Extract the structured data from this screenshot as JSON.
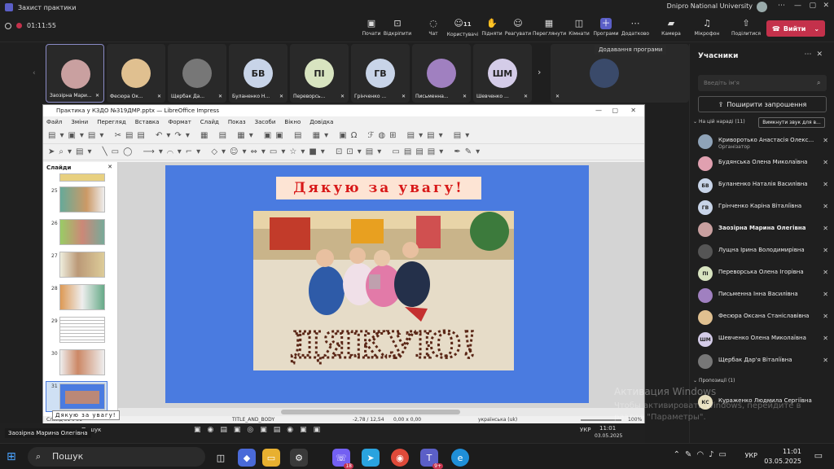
{
  "window": {
    "title": "Захист практики",
    "organization": "Dnipro National University"
  },
  "meeting": {
    "timer": "01:11:55",
    "leave_label": "Вийти"
  },
  "toolbar": {
    "items": [
      {
        "label": "Почати",
        "icon": "camera-icon"
      },
      {
        "label": "Відкріпити",
        "icon": "unpin-icon"
      },
      {
        "label": "Чат",
        "icon": "chat-icon"
      },
      {
        "label": "Користувачі",
        "icon": "people-icon",
        "count": "11"
      },
      {
        "label": "Підняти",
        "icon": "hand-icon"
      },
      {
        "label": "Реагувати",
        "icon": "smile-icon"
      },
      {
        "label": "Переглянути",
        "icon": "grid-icon"
      },
      {
        "label": "Кімнати",
        "icon": "rooms-icon"
      },
      {
        "label": "Програми",
        "icon": "apps-icon"
      },
      {
        "label": "Додатково",
        "icon": "more-icon"
      },
      {
        "label": "Камера",
        "icon": "video-icon"
      },
      {
        "label": "Мікрофон",
        "icon": "mic-icon"
      },
      {
        "label": "Поділитися",
        "icon": "share-icon"
      }
    ],
    "tooltip": "Додавання програми"
  },
  "tiles": [
    {
      "name": "Заозірна Мари...",
      "initials": "",
      "color": "#c9a0a0"
    },
    {
      "name": "Фесюра Ок...",
      "initials": "",
      "color": "#e0c090"
    },
    {
      "name": "Щербак Да...",
      "initials": "",
      "color": "#777777"
    },
    {
      "name": "Буланенко Н...",
      "initials": "БВ",
      "color": "#c8d4e8"
    },
    {
      "name": "Переворсь...",
      "initials": "ПІ",
      "color": "#d8e4c0"
    },
    {
      "name": "Грінченко ...",
      "initials": "ГВ",
      "color": "#c8d4e8"
    },
    {
      "name": "Письменна...",
      "initials": "",
      "color": "#a080c0"
    },
    {
      "name": "Шевченко ...",
      "initials": "ШМ",
      "color": "#d4cce8"
    },
    {
      "name": "",
      "initials": "",
      "color": "#3a4a6a"
    }
  ],
  "impress": {
    "title": "Практика у КЗДО №319ДМР.pptx — LibreOffice Impress",
    "menu": [
      "Файл",
      "Зміни",
      "Перегляд",
      "Вставка",
      "Формат",
      "Слайд",
      "Показ",
      "Засоби",
      "Вікно",
      "Довідка"
    ],
    "slides_header": "Слайди",
    "thumbnails": [
      "25",
      "26",
      "27",
      "28",
      "29",
      "30",
      "31"
    ],
    "slide_title": "Дякую за увагу!",
    "photo_word": "ДЯКУЮ!",
    "status": {
      "slide": "Слайд 31 з 31",
      "layout": "TITLE_AND_BODY",
      "position": "-2,78 / 12,54",
      "size": "0,00 x 0,00",
      "language": "українська (uk)",
      "zoom": "100%"
    },
    "slide_tooltip": "Дякую за увагу!"
  },
  "panel": {
    "title": "Учасники",
    "search_placeholder": "Введіть ім'я",
    "invite_label": "Поширити запрошення",
    "section_label": "На цій нараді (11)",
    "mute_label": "Вимкнути звук для в...",
    "people": [
      {
        "name": "Криворотько Анастасія Олекс...",
        "role": "Організатор",
        "initials": "",
        "color": "#8fa3b8"
      },
      {
        "name": "Будянська Олена Миколаївна",
        "role": "",
        "initials": "",
        "color": "#e0a0b0"
      },
      {
        "name": "Буланенко Наталія Василівна",
        "role": "",
        "initials": "БВ",
        "color": "#c8d4e8"
      },
      {
        "name": "Грінченко Каріна Віталіївна",
        "role": "",
        "initials": "ГВ",
        "color": "#c8d4e8"
      },
      {
        "name": "Заозірна Марина Олегівна",
        "role": "",
        "initials": "",
        "color": "#c9a0a0"
      },
      {
        "name": "Лущна Ірина Володимирівна",
        "role": "",
        "initials": "",
        "color": "#555555"
      },
      {
        "name": "Переворська Олена Ігорівна",
        "role": "",
        "initials": "ПІ",
        "color": "#d8e4c0"
      },
      {
        "name": "Письменна Інна Василівна",
        "role": "",
        "initials": "",
        "color": "#a080c0"
      },
      {
        "name": "Фесюра Оксана Станіславівна",
        "role": "",
        "initials": "",
        "color": "#e0c090"
      },
      {
        "name": "Шевченко Олена Миколаївна",
        "role": "",
        "initials": "ШМ",
        "color": "#d4cce8"
      },
      {
        "name": "Щербак Дар'я Віталіївна",
        "role": "",
        "initials": "",
        "color": "#777777"
      }
    ],
    "section2_label": "Пропозиції (1)",
    "proposal": {
      "name": "Кураженко Людмила Сергіївна",
      "initials": "КС",
      "color": "#e8e0c0"
    }
  },
  "watermark": {
    "line1": "Активация Windows",
    "line2": "Чтобы активировать Windows, перейдите в раздел \"Параметры\"."
  },
  "share_name": "Заозірна Марина Олегівна",
  "inner_taskbar": {
    "search": "Пошук",
    "lang": "УКР",
    "time": "11:01",
    "date": "03.05.2025"
  },
  "taskbar": {
    "search_label": "Пошук",
    "lang": "УКР",
    "time": "11:01",
    "date": "03.05.2025",
    "badges": {
      "viber": "18",
      "teams": "9+"
    }
  }
}
